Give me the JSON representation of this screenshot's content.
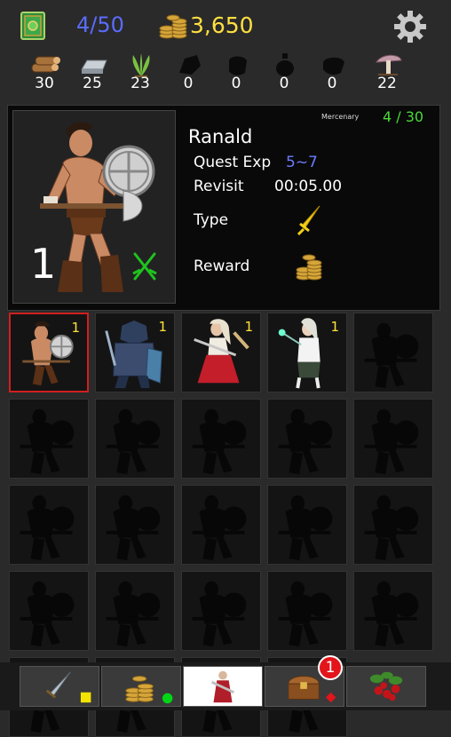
{
  "header": {
    "book_icon": "green-book-icon",
    "capacity": "4/50",
    "gold_icon": "gold-coins-icon",
    "gold": "3,650",
    "settings_icon": "gear-icon",
    "colors": {
      "capacity": "#5a6cff",
      "gold": "#ffe040"
    }
  },
  "resources": [
    {
      "icon": "wood-logs-icon",
      "count": "30"
    },
    {
      "icon": "iron-ingot-icon",
      "count": "25"
    },
    {
      "icon": "herb-icon",
      "count": "23"
    },
    {
      "icon": "locked-resource-icon",
      "count": "0"
    },
    {
      "icon": "locked-resource-icon",
      "count": "0"
    },
    {
      "icon": "locked-resource-icon",
      "count": "0"
    },
    {
      "icon": "locked-resource-icon",
      "count": "0"
    },
    {
      "icon": "mushroom-icon",
      "count": "22"
    }
  ],
  "detail": {
    "role": "Mercenary",
    "party_count": "4 / 30",
    "name": "Ranald",
    "level": "1",
    "quest_exp_label": "Quest Exp",
    "quest_exp_value": "5~7",
    "revisit_label": "Revisit",
    "revisit_value": "00:05.00",
    "type_label": "Type",
    "type_icon": "sword-icon",
    "reward_label": "Reward",
    "reward_icon": "gold-coins-icon",
    "class_icon": "crossed-swords-icon",
    "colors": {
      "party_count": "#4bd93a",
      "exp": "#6b7cff"
    }
  },
  "roster": [
    {
      "hero": "barbarian",
      "level": "1",
      "selected": true
    },
    {
      "hero": "dark-knight",
      "level": "1"
    },
    {
      "hero": "red-dress-warrior",
      "level": "1"
    },
    {
      "hero": "mage-girl",
      "level": "1"
    },
    {
      "hero": "locked"
    },
    {
      "hero": "locked"
    },
    {
      "hero": "locked"
    },
    {
      "hero": "locked"
    },
    {
      "hero": "locked"
    },
    {
      "hero": "locked"
    },
    {
      "hero": "locked"
    },
    {
      "hero": "locked"
    },
    {
      "hero": "locked"
    },
    {
      "hero": "locked"
    },
    {
      "hero": "locked"
    },
    {
      "hero": "locked"
    },
    {
      "hero": "locked"
    },
    {
      "hero": "locked"
    },
    {
      "hero": "locked"
    },
    {
      "hero": "locked"
    },
    {
      "hero": "locked"
    },
    {
      "hero": "locked"
    },
    {
      "hero": "locked"
    },
    {
      "hero": "locked"
    }
  ],
  "nav": {
    "tabs": [
      {
        "icon": "sword-icon",
        "marker": "yellow-square"
      },
      {
        "icon": "gold-coins-icon",
        "marker": "green-circle"
      },
      {
        "icon": "hero-icon",
        "active": true
      },
      {
        "icon": "treasure-chest-icon",
        "marker": "red-diamond"
      },
      {
        "icon": "berries-icon"
      }
    ],
    "notification_count": "1"
  }
}
